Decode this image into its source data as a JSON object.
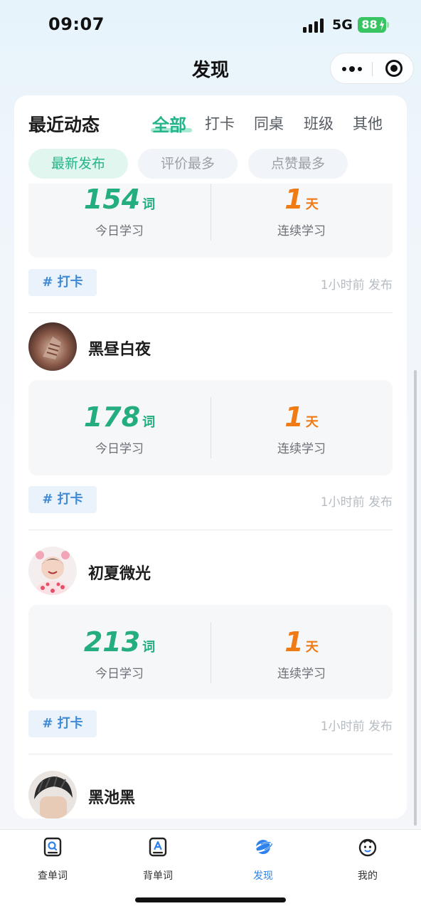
{
  "status": {
    "time": "09:07",
    "network": "5G",
    "battery": "88"
  },
  "header": {
    "title": "发现",
    "more_icon": "more-dots-icon",
    "close_icon": "target-close-icon"
  },
  "section": {
    "title": "最近动态",
    "tabs": [
      "全部",
      "打卡",
      "同桌",
      "班级",
      "其他"
    ],
    "active_tab": "全部",
    "chips": [
      "最新发布",
      "评价最多",
      "点赞最多"
    ],
    "active_chip": "最新发布"
  },
  "posts": [
    {
      "user": "",
      "words": "154",
      "words_unit": "词",
      "words_label": "今日学习",
      "days": "1",
      "days_unit": "天",
      "days_label": "连续学习",
      "tag": "# 打卡",
      "time": "1小时前 发布"
    },
    {
      "user": "黑昼白夜",
      "words": "178",
      "words_unit": "词",
      "words_label": "今日学习",
      "days": "1",
      "days_unit": "天",
      "days_label": "连续学习",
      "tag": "# 打卡",
      "time": "1小时前 发布"
    },
    {
      "user": "初夏微光",
      "words": "213",
      "words_unit": "词",
      "words_label": "今日学习",
      "days": "1",
      "days_unit": "天",
      "days_label": "连续学习",
      "tag": "# 打卡",
      "time": "1小时前 发布"
    },
    {
      "user": "黑池黑"
    }
  ],
  "tabbar": {
    "items": [
      {
        "label": "查单词",
        "icon": "search-word-icon"
      },
      {
        "label": "背单词",
        "icon": "word-card-icon"
      },
      {
        "label": "发现",
        "icon": "planet-icon",
        "active": true
      },
      {
        "label": "我的",
        "icon": "profile-face-icon"
      }
    ]
  },
  "colors": {
    "accent_green": "#26b58a",
    "accent_orange": "#f07a14",
    "tab_active_blue": "#2f82ec",
    "tag_blue": "#3f8ad3"
  }
}
